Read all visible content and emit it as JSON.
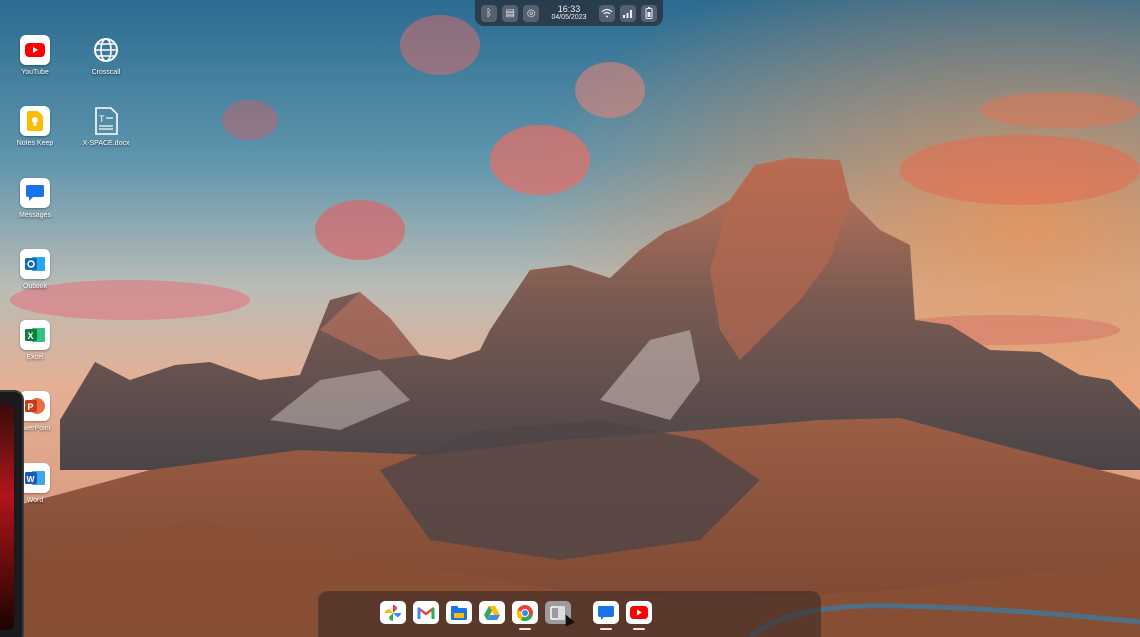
{
  "status_bar": {
    "time": "16:33",
    "date": "04/05/2023",
    "icons": [
      "bluetooth-icon",
      "sd-card-icon",
      "vr-icon",
      "wifi-icon",
      "signal-icon",
      "battery-icon"
    ]
  },
  "desktop_icons": [
    {
      "label": "YouTube",
      "icon": "youtube-icon"
    },
    {
      "label": "Crosscall",
      "icon": "globe-icon"
    },
    {
      "label": "Notes Keep",
      "icon": "keep-notes-icon"
    },
    {
      "label": "X-SPACE.docx",
      "icon": "document-icon"
    },
    {
      "label": "Messages",
      "icon": "messages-icon"
    },
    {
      "label": "Outlook",
      "icon": "outlook-icon"
    },
    {
      "label": "Excel",
      "icon": "excel-icon"
    },
    {
      "label": "owerPoint",
      "icon": "powerpoint-icon"
    },
    {
      "label": "Word",
      "icon": "word-icon"
    }
  ],
  "dock_apps": [
    "photos-icon",
    "gmail-icon",
    "files-icon",
    "drive-icon",
    "chrome-icon",
    "multitask-icon",
    "messages-icon",
    "youtube-icon"
  ],
  "colors": {
    "youtube": "#ff0000",
    "keep": "#fbbc04",
    "messages": "#1a73e8",
    "outlook": "#0f6cbd",
    "excel": "#107c41",
    "powerpoint": "#c43e1c",
    "word": "#185abd"
  }
}
